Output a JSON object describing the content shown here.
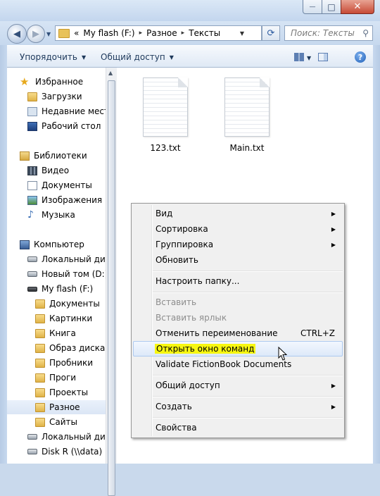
{
  "window": {
    "close_glyph": "✕",
    "max_glyph": "□",
    "min_glyph": "—"
  },
  "navigation": {
    "back_glyph": "◀",
    "forward_glyph": "▶",
    "refresh_glyph": "⟳"
  },
  "address": {
    "overflow": "«",
    "segments": [
      "My flash (F:)",
      "Разное",
      "Тексты"
    ],
    "separator": "▸"
  },
  "search": {
    "placeholder": "Поиск: Тексты",
    "icon": "search-icon"
  },
  "toolbar": {
    "organize": "Упорядочить",
    "share": "Общий доступ",
    "help": "?"
  },
  "sidebar": {
    "favorites": "Избранное",
    "downloads": "Загрузки",
    "recent": "Недавние места",
    "desktop": "Рабочий стол",
    "libraries": "Библиотеки",
    "video": "Видео",
    "documents": "Документы",
    "images": "Изображения",
    "music": "Музыка",
    "computer": "Компьютер",
    "local_disk": "Локальный диск",
    "new_volume": "Новый том (D:)",
    "flash": "My flash (F:)",
    "f_docs": "Документы",
    "f_pics": "Картинки",
    "f_book": "Книга",
    "f_image": "Образ диска",
    "f_probes": "Пробники",
    "f_progs": "Проги",
    "f_projects": "Проекты",
    "f_misc": "Разное",
    "f_sites": "Сайты",
    "local_disk2": "Локальный диск",
    "disk_r": "Disk R (\\\\data) (R"
  },
  "files": [
    {
      "name": "123.txt"
    },
    {
      "name": "Main.txt"
    }
  ],
  "context_menu": {
    "view": "Вид",
    "sort": "Сортировка",
    "group": "Группировка",
    "refresh": "Обновить",
    "customize": "Настроить папку...",
    "paste": "Вставить",
    "paste_shortcut": "Вставить ярлык",
    "undo_rename": "Отменить переименование",
    "undo_shortcut": "CTRL+Z",
    "open_cmd": "Открыть окно команд",
    "validate": "Validate FictionBook Documents",
    "share": "Общий доступ",
    "create": "Создать",
    "properties": "Свойства",
    "arrow": "▶"
  },
  "colors": {
    "highlight": "#f7f711",
    "accent": "#1f5fb8"
  }
}
